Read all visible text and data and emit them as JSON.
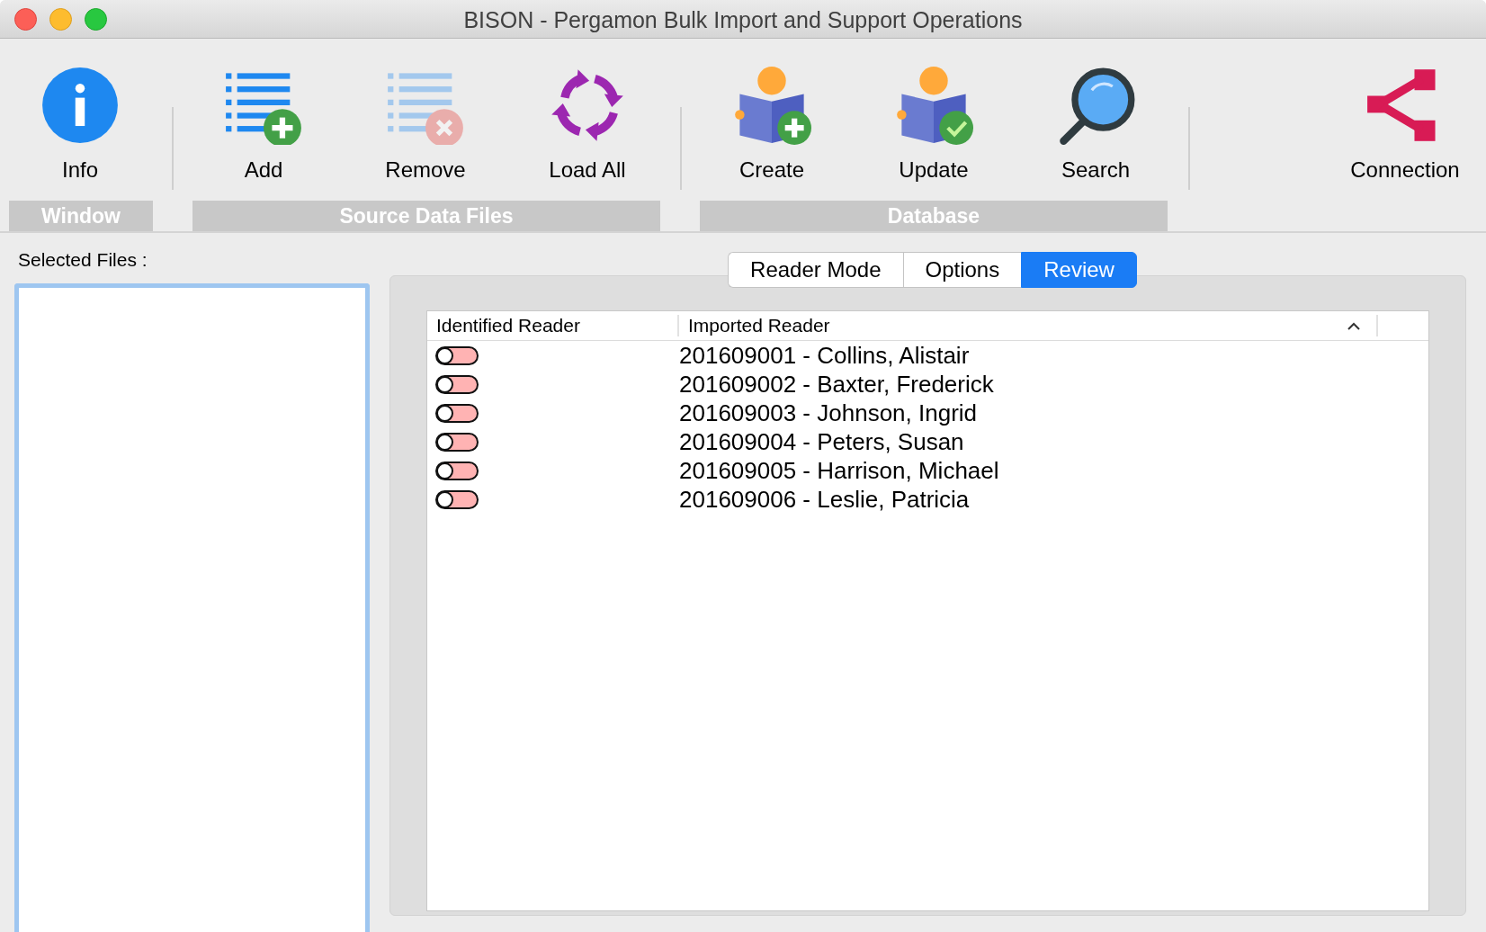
{
  "window": {
    "title": "BISON - Pergamon Bulk Import and Support Operations"
  },
  "toolbar": {
    "groups": [
      {
        "label": "Window",
        "tools": [
          {
            "label": "Info",
            "kind": "info",
            "disabled": false
          }
        ]
      },
      {
        "label": "Source Data Files",
        "tools": [
          {
            "label": "Add",
            "kind": "add",
            "disabled": false
          },
          {
            "label": "Remove",
            "kind": "remove",
            "disabled": true
          },
          {
            "label": "Load All",
            "kind": "load",
            "disabled": false
          }
        ]
      },
      {
        "label": "Database",
        "tools": [
          {
            "label": "Create",
            "kind": "create",
            "disabled": false
          },
          {
            "label": "Update",
            "kind": "update",
            "disabled": false
          },
          {
            "label": "Search",
            "kind": "search",
            "disabled": false
          }
        ]
      }
    ],
    "extra_tools": [
      {
        "label": "Connection",
        "kind": "connection",
        "disabled": false
      }
    ]
  },
  "sidebar": {
    "label": "Selected Files :"
  },
  "tabs": [
    {
      "label": "Reader Mode",
      "selected": false
    },
    {
      "label": "Options",
      "selected": false
    },
    {
      "label": "Review",
      "selected": true
    }
  ],
  "table": {
    "columns": [
      {
        "label": "Identified Reader",
        "sorted": false
      },
      {
        "label": "Imported Reader",
        "sorted": true
      }
    ],
    "rows": [
      {
        "identified": false,
        "imported": "201609001 - Collins, Alistair"
      },
      {
        "identified": false,
        "imported": "201609002 - Baxter, Frederick"
      },
      {
        "identified": false,
        "imported": "201609003 - Johnson, Ingrid"
      },
      {
        "identified": false,
        "imported": "201609004 - Peters, Susan"
      },
      {
        "identified": false,
        "imported": "201609005 - Harrison, Michael"
      },
      {
        "identified": false,
        "imported": "201609006 - Leslie, Patricia"
      }
    ]
  }
}
